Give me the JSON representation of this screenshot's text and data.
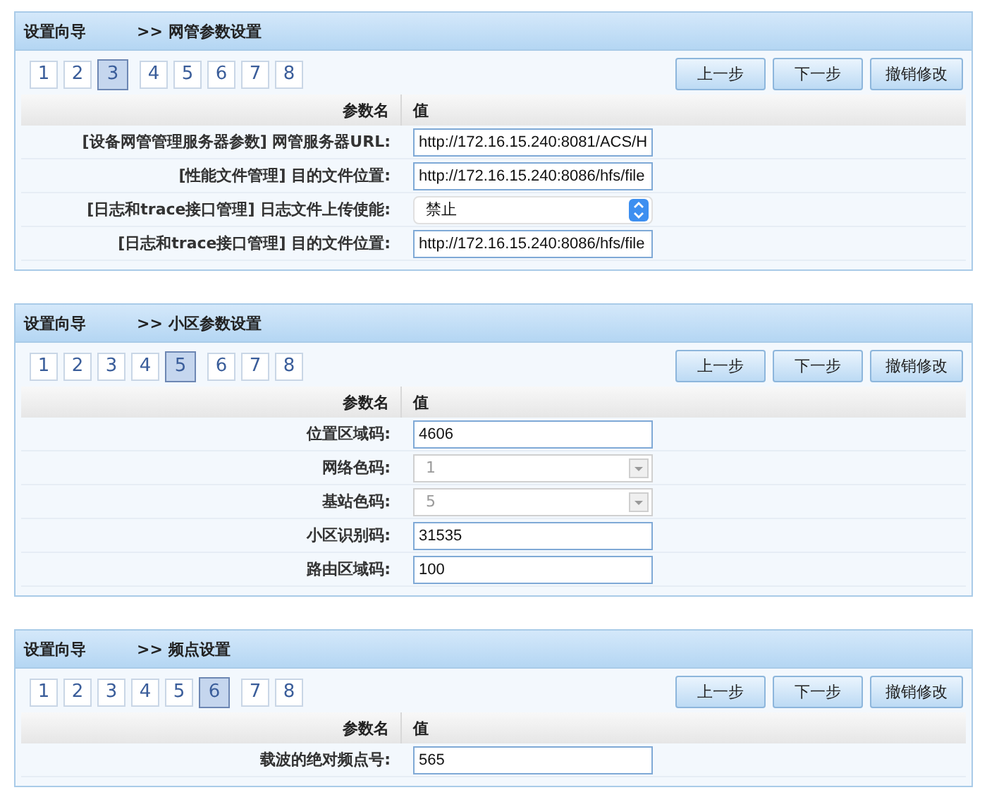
{
  "panels": [
    {
      "title": "设置向导",
      "section": ">> 网管参数设置",
      "steps": [
        {
          "label": "1",
          "selected": false
        },
        {
          "label": "2",
          "selected": false
        },
        {
          "label": "3",
          "selected": true
        },
        {
          "label": "4",
          "selected": false
        },
        {
          "label": "5",
          "selected": false
        },
        {
          "label": "6",
          "selected": false
        },
        {
          "label": "7",
          "selected": false
        },
        {
          "label": "8",
          "selected": false
        }
      ],
      "buttons": [
        "上一步",
        "下一步",
        "撤销修改"
      ],
      "columns": [
        "参数名",
        "值"
      ],
      "rows": [
        {
          "kind": "text",
          "label": "[设备网管管理服务器参数] 网管服务器URL:",
          "value": "http://172.16.15.240:8081/ACS/H"
        },
        {
          "kind": "text",
          "label": "[性能文件管理] 目的文件位置:",
          "value": "http://172.16.15.240:8086/hfs/file"
        },
        {
          "kind": "select",
          "label": "[日志和trace接口管理] 日志文件上传使能:",
          "value": "禁止",
          "disabled": false
        },
        {
          "kind": "text",
          "label": "[日志和trace接口管理] 目的文件位置:",
          "value": "http://172.16.15.240:8086/hfs/file"
        }
      ]
    },
    {
      "title": "设置向导",
      "section": ">> 小区参数设置",
      "steps": [
        {
          "label": "1",
          "selected": false
        },
        {
          "label": "2",
          "selected": false
        },
        {
          "label": "3",
          "selected": false
        },
        {
          "label": "4",
          "selected": false
        },
        {
          "label": "5",
          "selected": true
        },
        {
          "label": "6",
          "selected": false
        },
        {
          "label": "7",
          "selected": false
        },
        {
          "label": "8",
          "selected": false
        }
      ],
      "buttons": [
        "上一步",
        "下一步",
        "撤销修改"
      ],
      "columns": [
        "参数名",
        "值"
      ],
      "rows": [
        {
          "kind": "text",
          "label": "位置区域码:",
          "value": "4606"
        },
        {
          "kind": "select",
          "label": "网络色码:",
          "value": "1",
          "disabled": true
        },
        {
          "kind": "select",
          "label": "基站色码:",
          "value": "5",
          "disabled": true
        },
        {
          "kind": "text",
          "label": "小区识别码:",
          "value": "31535"
        },
        {
          "kind": "text",
          "label": "路由区域码:",
          "value": "100"
        }
      ]
    },
    {
      "title": "设置向导",
      "section": ">> 频点设置",
      "steps": [
        {
          "label": "1",
          "selected": false
        },
        {
          "label": "2",
          "selected": false
        },
        {
          "label": "3",
          "selected": false
        },
        {
          "label": "4",
          "selected": false
        },
        {
          "label": "5",
          "selected": false
        },
        {
          "label": "6",
          "selected": true
        },
        {
          "label": "7",
          "selected": false
        },
        {
          "label": "8",
          "selected": false
        }
      ],
      "buttons": [
        "上一步",
        "下一步",
        "撤销修改"
      ],
      "columns": [
        "参数名",
        "值"
      ],
      "rows": [
        {
          "kind": "text",
          "label": "载波的绝对频点号:",
          "value": "565"
        }
      ]
    }
  ]
}
